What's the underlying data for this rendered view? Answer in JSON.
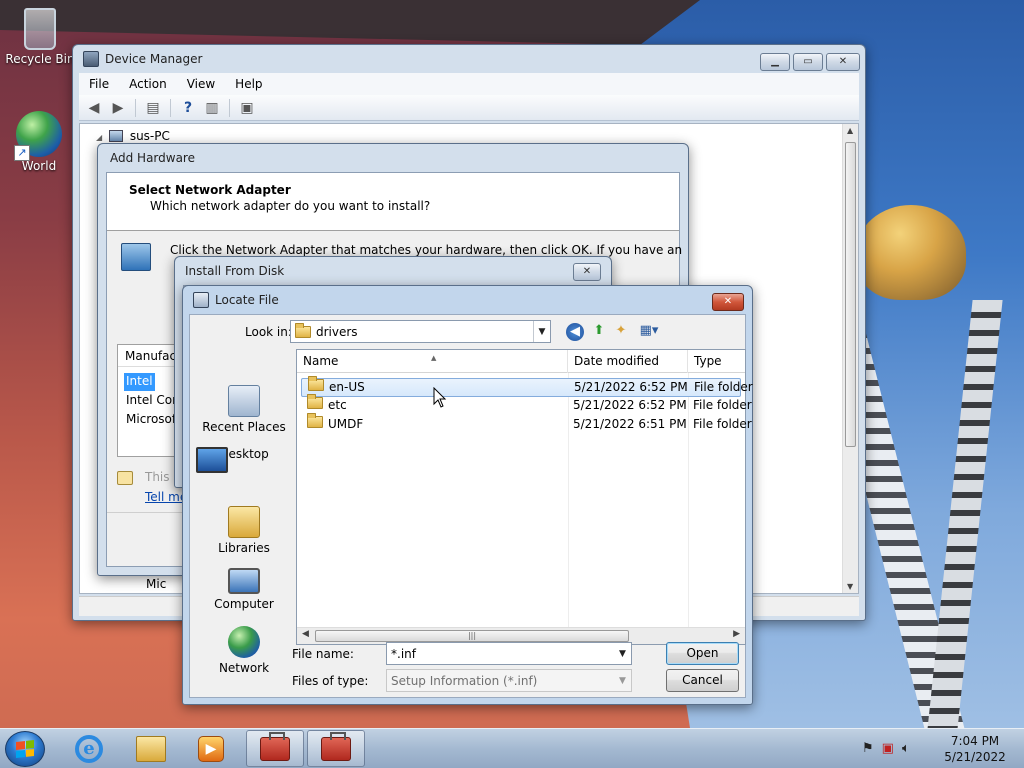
{
  "desktop": {
    "icons": [
      {
        "label": "Recycle Bin",
        "icon": "recycle-bin-icon"
      },
      {
        "label": "World",
        "icon": "globe-shortcut-icon"
      }
    ]
  },
  "device_manager": {
    "title": "Device Manager",
    "menu": [
      "File",
      "Action",
      "View",
      "Help"
    ],
    "toolbar_icons": [
      "back-arrow-icon",
      "forward-arrow-icon",
      "properties-icon",
      "help-icon",
      "show-hide-tree-icon",
      "scan-hardware-icon"
    ],
    "tree_root": "sus-PC",
    "tree_partial_item": "Mic"
  },
  "add_hardware": {
    "title": "Add Hardware",
    "header_title": "Select Network Adapter",
    "header_subtitle": "Which network adapter do you want to install?",
    "instruction": "Click the Network Adapter that matches your hardware, then click OK. If you have an",
    "manufacturer_header": "Manufact",
    "manufacturers": [
      "Intel",
      "Intel Corp",
      "Microsoft"
    ],
    "selected_manufacturer": "Intel",
    "signed_text": "This d",
    "link": "Tell me"
  },
  "install_from_disk": {
    "title": "Install From Disk"
  },
  "locate_file": {
    "title": "Locate File",
    "look_in_label": "Look in:",
    "look_in_value": "drivers",
    "places": [
      {
        "label": "Recent Places",
        "icon": "recent-places-icon"
      },
      {
        "label": "Desktop",
        "icon": "desktop-icon"
      },
      {
        "label": "Libraries",
        "icon": "libraries-icon"
      },
      {
        "label": "Computer",
        "icon": "computer-icon"
      },
      {
        "label": "Network",
        "icon": "network-icon"
      }
    ],
    "columns": [
      "Name",
      "Date modified",
      "Type"
    ],
    "files": [
      {
        "name": "en-US",
        "date": "5/21/2022 6:52 PM",
        "type": "File folder"
      },
      {
        "name": "etc",
        "date": "5/21/2022 6:52 PM",
        "type": "File folder"
      },
      {
        "name": "UMDF",
        "date": "5/21/2022 6:51 PM",
        "type": "File folder"
      }
    ],
    "selected_file": "en-US",
    "file_name_label": "File name:",
    "file_name_value": "*.inf",
    "file_type_label": "Files of type:",
    "file_type_value": "Setup Information (*.inf)",
    "open_button": "Open",
    "cancel_button": "Cancel"
  },
  "taskbar": {
    "time": "7:04 PM",
    "date": "5/21/2022",
    "pinned": [
      "internet-explorer-icon",
      "windows-explorer-icon",
      "media-player-icon",
      "toolbox-app-icon",
      "toolbox-app-icon"
    ]
  }
}
